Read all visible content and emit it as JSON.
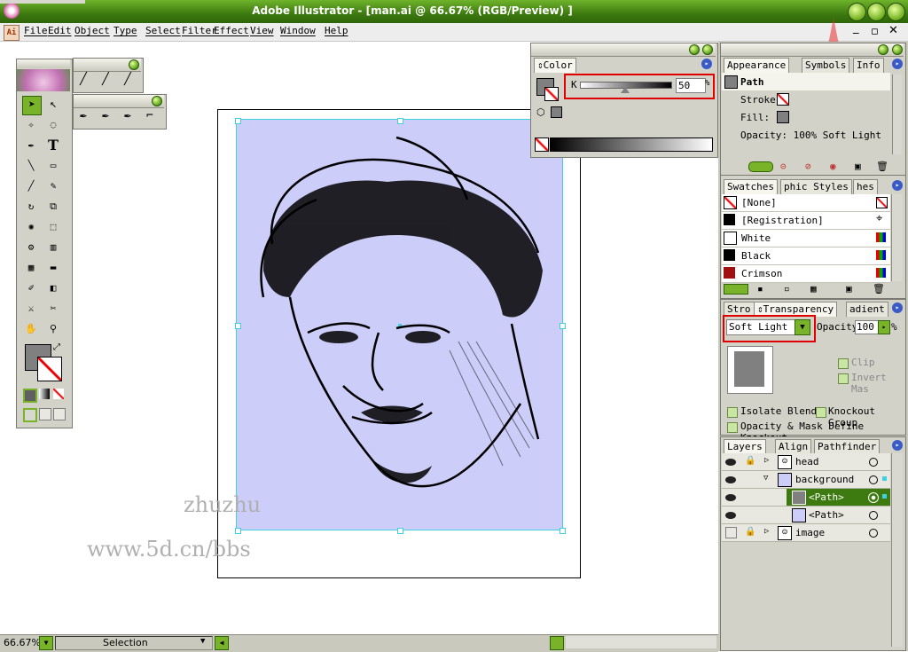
{
  "window": {
    "title": "Adobe Illustrator - [man.ai @ 66.67% (RGB/Preview) ]"
  },
  "menu": [
    "File",
    "Edit",
    "Object",
    "Type",
    "Select",
    "Filter",
    "Effect",
    "View",
    "Window",
    "Help"
  ],
  "color_panel": {
    "tab": "Color",
    "channel": "K",
    "value": "50",
    "unit": "%"
  },
  "appearance_panel": {
    "tabs": [
      "Appearance",
      "Symbols",
      "Info"
    ],
    "item": "Path",
    "stroke_label": "Stroke:",
    "fill_label": "Fill:",
    "opacity_text": "Opacity: 100% Soft Light"
  },
  "swatches_panel": {
    "tabs": [
      "Swatches",
      "phic Styles",
      "hes"
    ],
    "swatches": [
      {
        "name": "[None]",
        "color": "#ffffff"
      },
      {
        "name": "[Registration]",
        "color": "#000000"
      },
      {
        "name": "White",
        "color": "#ffffff"
      },
      {
        "name": "Black",
        "color": "#000000"
      },
      {
        "name": "Crimson",
        "color": "#a01010"
      }
    ]
  },
  "transparency_panel": {
    "tabs": [
      "Stro",
      "Transparency",
      "adient"
    ],
    "blend_mode": "Soft Light",
    "opacity_label": "Opacity",
    "opacity_value": "100",
    "opacity_unit": "%",
    "clip": "Clip",
    "invert_mask": "Invert Mas",
    "isolate_blend": "Isolate Blend",
    "knockout_group": "Knockout Group",
    "opacity_mask": "Opacity & Mask Define Knockout"
  },
  "layers_panel": {
    "tabs": [
      "Layers",
      "Align",
      "Pathfinder"
    ],
    "layers": [
      {
        "name": "head",
        "expanded": false,
        "selected": false,
        "indent": 0
      },
      {
        "name": "background",
        "expanded": true,
        "selected": false,
        "indent": 0
      },
      {
        "name": "<Path>",
        "expanded": false,
        "selected": true,
        "indent": 1
      },
      {
        "name": "<Path>",
        "expanded": false,
        "selected": false,
        "indent": 1
      },
      {
        "name": "image",
        "expanded": false,
        "selected": false,
        "indent": 0
      }
    ]
  },
  "watermark": {
    "line1": "zhuzhu",
    "line2": "www.5d.cn/bbs"
  },
  "statusbar": {
    "zoom": "66.67%",
    "mode": "Selection"
  },
  "colors": {
    "titlebar": "#3d7a10",
    "accent": "#78b32a",
    "artboard": "#cccdf8",
    "highlight": "#e00000"
  },
  "icons": [
    "ai-app-icon",
    "selection-tool-icon",
    "direct-selection-tool-icon",
    "pen-tool-icon",
    "type-tool-icon",
    "eye-icon",
    "lock-icon",
    "layer-thumbnail-icon"
  ]
}
